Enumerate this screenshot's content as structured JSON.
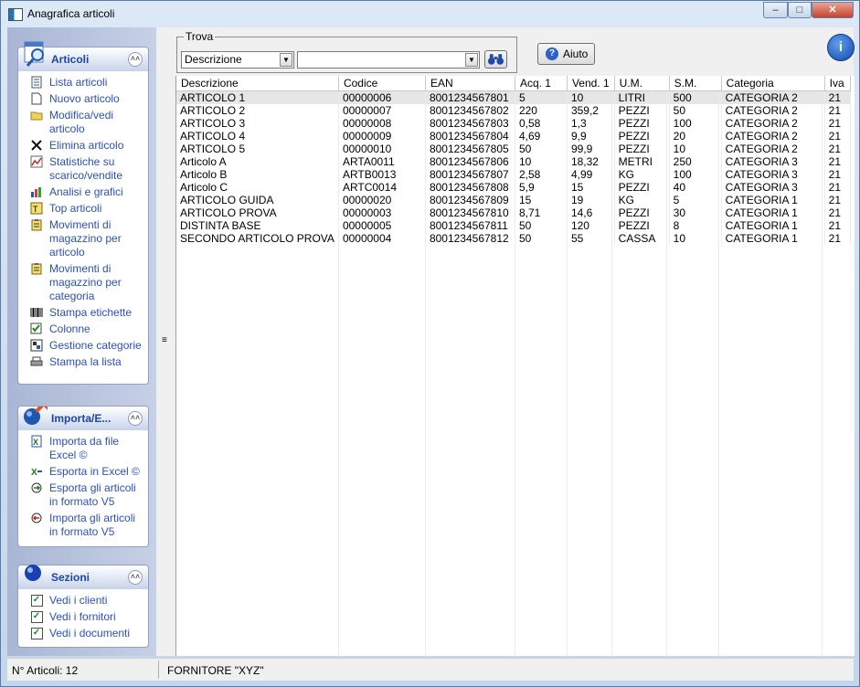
{
  "window": {
    "title": "Anagrafica articoli"
  },
  "sidebar": {
    "articoli": {
      "title": "Articoli",
      "items": [
        {
          "label": "Lista articoli",
          "icon": "document-list-icon"
        },
        {
          "label": "Nuovo articolo",
          "icon": "new-document-icon"
        },
        {
          "label": "Modifica/vedi articolo",
          "icon": "folder-icon"
        },
        {
          "label": "Elimina articolo",
          "icon": "delete-x-icon"
        },
        {
          "label": "Statistiche su scarico/vendite",
          "icon": "line-chart-icon"
        },
        {
          "label": "Analisi e grafici",
          "icon": "chart-analysis-icon"
        },
        {
          "label": "Top articoli",
          "icon": "top-trophy-icon"
        },
        {
          "label": "Movimenti di magazzino per articolo",
          "icon": "clipboard-icon"
        },
        {
          "label": "Movimenti di magazzino per categoria",
          "icon": "clipboard-icon"
        },
        {
          "label": "Stampa etichette",
          "icon": "barcode-icon"
        },
        {
          "label": "Colonne",
          "icon": "checkbox-icon"
        },
        {
          "label": "Gestione categorie",
          "icon": "category-icon"
        },
        {
          "label": "Stampa la lista",
          "icon": "printer-icon"
        }
      ]
    },
    "importa": {
      "title": "Importa/E...",
      "items": [
        {
          "label": "Importa da file Excel ©",
          "icon": "excel-import-icon"
        },
        {
          "label": "Esporta in Excel ©",
          "icon": "excel-export-icon"
        },
        {
          "label": "Esporta gli articoli in formato V5",
          "icon": "export-arrow-icon"
        },
        {
          "label": "Importa gli articoli in formato V5",
          "icon": "import-arrow-icon"
        }
      ]
    },
    "sezioni": {
      "title": "Sezioni",
      "items": [
        {
          "label": "Vedi i clienti",
          "checked": true
        },
        {
          "label": "Vedi i fornitori",
          "checked": true
        },
        {
          "label": "Vedi i documenti",
          "checked": true
        }
      ]
    }
  },
  "search": {
    "group_label": "Trova",
    "field_value": "Descrizione",
    "search_value": "",
    "help_label": "Aiuto"
  },
  "table": {
    "columns": [
      "Descrizione",
      "Codice",
      "EAN",
      "Acq. 1",
      "Vend. 1",
      "U.M.",
      "S.M.",
      "Categoria",
      "Iva"
    ],
    "rows": [
      [
        "ARTICOLO 1",
        "00000006",
        "8001234567801",
        "5",
        "10",
        "LITRI",
        "500",
        "CATEGORIA 2",
        "21"
      ],
      [
        "ARTICOLO 2",
        "00000007",
        "8001234567802",
        "220",
        "359,2",
        "PEZZI",
        "50",
        "CATEGORIA 2",
        "21"
      ],
      [
        "ARTICOLO 3",
        "00000008",
        "8001234567803",
        "0,58",
        "1,3",
        "PEZZI",
        "100",
        "CATEGORIA 2",
        "21"
      ],
      [
        "ARTICOLO 4",
        "00000009",
        "8001234567804",
        "4,69",
        "9,9",
        "PEZZI",
        "20",
        "CATEGORIA 2",
        "21"
      ],
      [
        "ARTICOLO 5",
        "00000010",
        "8001234567805",
        "50",
        "99,9",
        "PEZZI",
        "10",
        "CATEGORIA 2",
        "21"
      ],
      [
        "Articolo A",
        "ARTA0011",
        "8001234567806",
        "10",
        "18,32",
        "METRI",
        "250",
        "CATEGORIA 3",
        "21"
      ],
      [
        "Articolo B",
        "ARTB0013",
        "8001234567807",
        "2,58",
        "4,99",
        "KG",
        "100",
        "CATEGORIA 3",
        "21"
      ],
      [
        "Articolo C",
        "ARTC0014",
        "8001234567808",
        "5,9",
        "15",
        "PEZZI",
        "40",
        "CATEGORIA 3",
        "21"
      ],
      [
        "ARTICOLO GUIDA",
        "00000020",
        "8001234567809",
        "15",
        "19",
        "KG",
        "5",
        "CATEGORIA 1",
        "21"
      ],
      [
        "ARTICOLO PROVA",
        "00000003",
        "8001234567810",
        "8,71",
        "14,6",
        "PEZZI",
        "30",
        "CATEGORIA 1",
        "21"
      ],
      [
        "DISTINTA BASE",
        "00000005",
        "8001234567811",
        "50",
        "120",
        "PEZZI",
        "8",
        "CATEGORIA 1",
        "21"
      ],
      [
        "SECONDO ARTICOLO PROVA",
        "00000004",
        "8001234567812",
        "50",
        "55",
        "CASSA",
        "10",
        "CATEGORIA 1",
        "21"
      ]
    ]
  },
  "status": {
    "count": "N° Articoli: 12",
    "supplier": "FORNITORE \"XYZ\""
  }
}
